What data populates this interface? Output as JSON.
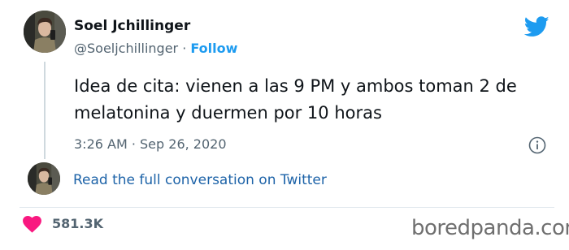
{
  "tweet": {
    "display_name": "Soel Jchillinger",
    "handle": "@Soeljchillinger",
    "separator": " · ",
    "follow_label": "Follow",
    "text": "Idea de cita: vienen a las 9 PM y ambos toman 2 de melatonina y duermen por 10 horas",
    "timestamp": "3:26 AM · Sep 26, 2020",
    "conversation_link": "Read the full conversation on Twitter",
    "like_count": "581.3K"
  },
  "icons": {
    "logo": "twitter-bird-icon",
    "info": "info-icon",
    "like": "heart-icon"
  },
  "watermark": "boredpanda.com",
  "colors": {
    "twitter_blue": "#1d9bf0",
    "link_blue": "#1d63a8",
    "heart_pink": "#f91880",
    "secondary_text": "#536471"
  }
}
